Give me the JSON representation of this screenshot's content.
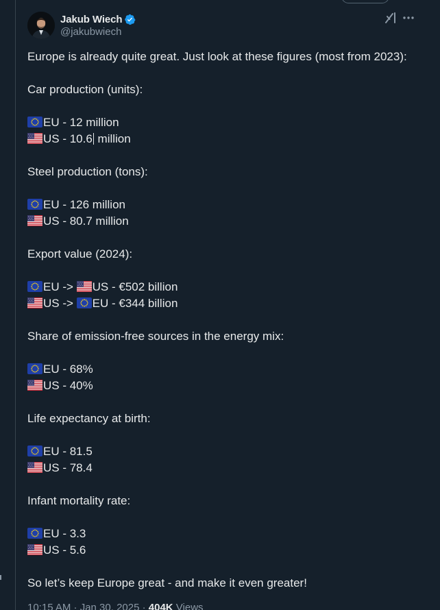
{
  "author": {
    "display_name": "Jakub Wiech",
    "handle": "@jakubwiech",
    "verified": true
  },
  "post": {
    "intro": "Europe is already quite great. Just look at these figures (most from 2023):",
    "sections": {
      "car": {
        "heading": "Car production (units):",
        "eu": "EU - 12 million",
        "us_before_caret": "US - 10.6",
        "us_after_caret": " million"
      },
      "steel": {
        "heading": "Steel production (tons):",
        "eu": "EU - 126 million",
        "us": "US - 80.7 million"
      },
      "export": {
        "heading": "Export value (2024):",
        "eu_us_prefix": "EU -> ",
        "eu_us_value": "US - €502 billion",
        "us_eu_prefix": "US -> ",
        "us_eu_value": "EU - €344 billion"
      },
      "energy": {
        "heading": "Share of emission-free sources in the energy mix:",
        "eu": "EU - 68%",
        "us": "US - 40%"
      },
      "life": {
        "heading": "Life expectancy at birth:",
        "eu": "EU - 81.5",
        "us": "US - 78.4"
      },
      "infant": {
        "heading": "Infant mortality rate:",
        "eu": "EU - 3.3",
        "us": "US - 5.6"
      }
    },
    "closing": "So let’s keep Europe great - and make it even greater!",
    "meta": {
      "time": "10:15 AM · Jan 30, 2025 · ",
      "views_count": "404K",
      "views_label": " Views"
    }
  },
  "colors": {
    "background": "#15202b",
    "text": "#e7e9ea",
    "secondary": "#8b98a5",
    "verified": "#1d9bf0"
  },
  "icons": {
    "verified": "verified-badge-icon",
    "grok": "grok-icon",
    "more": "more-icon",
    "eu_flag": "eu-flag-icon",
    "us_flag": "us-flag-icon"
  }
}
